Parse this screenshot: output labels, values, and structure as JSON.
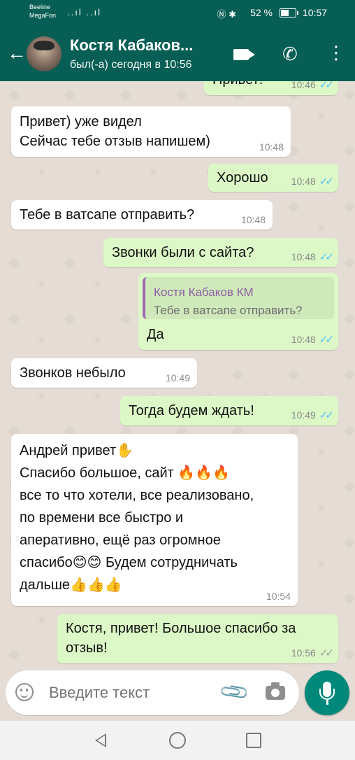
{
  "status_bar": {
    "carrier1": "Beeline",
    "carrier2": "MegaFon",
    "signal_icons": "..ıl ..ıl",
    "battery": "52 %",
    "time": "10:57"
  },
  "header": {
    "contact_name": "Костя Кабаков...",
    "last_seen": "был(-а) сегодня в 10:56",
    "icons": [
      "back-arrow-icon",
      "avatar",
      "video-call-icon",
      "phone-icon",
      "more-menu-icon"
    ]
  },
  "messages": [
    {
      "dir": "out",
      "text": "Привет!",
      "time": "10:46",
      "ticks": "read"
    },
    {
      "dir": "in",
      "text": "Привет) уже видел\nСейчас тебе отзыв напишем)",
      "time": "10:48"
    },
    {
      "dir": "out",
      "text": "Хорошо",
      "time": "10:48",
      "ticks": "read"
    },
    {
      "dir": "in",
      "text": "Тебе в ватсапе отправить?",
      "time": "10:48"
    },
    {
      "dir": "out",
      "text": "Звонки были с сайта?",
      "time": "10:48",
      "ticks": "read"
    },
    {
      "dir": "out",
      "quote_name": "Костя Кабаков КМ",
      "quote_text": "Тебе в ватсапе отправить?",
      "text": "Да",
      "time": "10:48",
      "ticks": "read"
    },
    {
      "dir": "in",
      "text": "Звонков небыло",
      "time": "10:49"
    },
    {
      "dir": "out",
      "text": "Тогда будем ждать!",
      "time": "10:49",
      "ticks": "read"
    },
    {
      "dir": "in",
      "lines": [
        "Андрей привет✋",
        "Спасибо большое, сайт 🔥🔥🔥",
        "все то что хотели, все реализовано,",
        "по времени все быстро и",
        "аперативно, ещё раз огромное",
        "спасибо😊😊 Будем сотрудничать",
        "дальше👍👍👍"
      ],
      "time": "10:54"
    },
    {
      "dir": "out",
      "text": "Костя, привет! Большое спасибо за\nотзыв!",
      "time": "10:56",
      "ticks": "delivered"
    }
  ],
  "tick_glyph": "✓✓",
  "input": {
    "placeholder": "Введите текст"
  },
  "colors": {
    "header": "#075e54",
    "outgoing": "#dcf8c6",
    "incoming": "#ffffff",
    "read_ticks": "#4fc3f7",
    "mic_button": "#00897b",
    "quote_name": "#8e5ea3"
  }
}
